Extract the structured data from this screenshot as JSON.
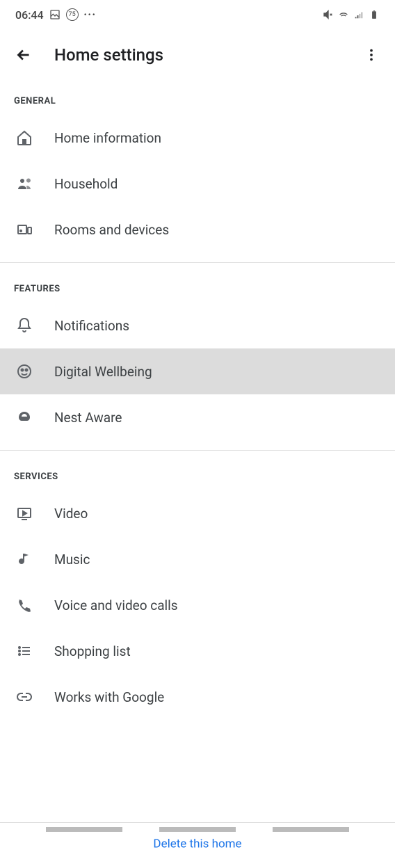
{
  "status": {
    "time": "06:44",
    "badge": "75"
  },
  "header": {
    "title": "Home settings"
  },
  "sections": {
    "general": {
      "label": "GENERAL",
      "items": [
        {
          "label": "Home information",
          "icon": "home"
        },
        {
          "label": "Household",
          "icon": "people"
        },
        {
          "label": "Rooms and devices",
          "icon": "devices"
        }
      ]
    },
    "features": {
      "label": "FEATURES",
      "items": [
        {
          "label": "Notifications",
          "icon": "bell"
        },
        {
          "label": "Digital Wellbeing",
          "icon": "wellbeing"
        },
        {
          "label": "Nest Aware",
          "icon": "nest"
        }
      ]
    },
    "services": {
      "label": "SERVICES",
      "items": [
        {
          "label": "Video",
          "icon": "video"
        },
        {
          "label": "Music",
          "icon": "music"
        },
        {
          "label": "Voice and video calls",
          "icon": "phone"
        },
        {
          "label": "Shopping list",
          "icon": "list"
        },
        {
          "label": "Works with Google",
          "icon": "link"
        }
      ]
    }
  },
  "footer": {
    "delete": "Delete this home"
  }
}
